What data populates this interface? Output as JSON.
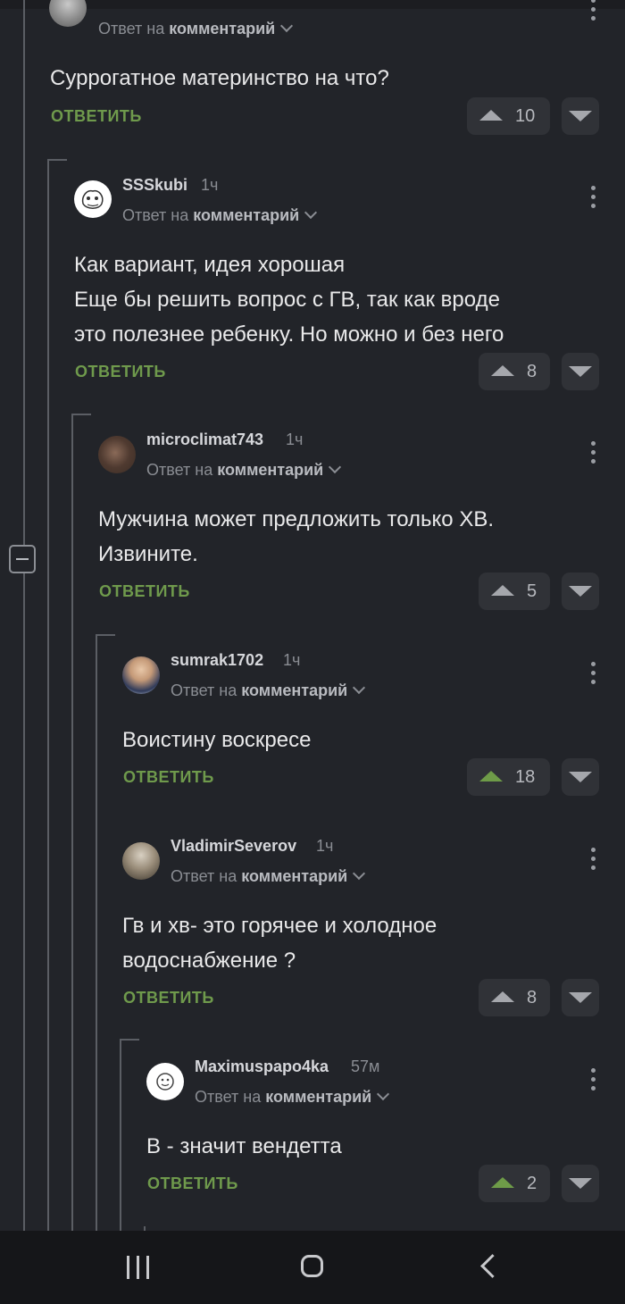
{
  "common": {
    "reply_to_prefix": "Ответ на",
    "reply_to_target": "комментарий",
    "reply_button": "ОТВЕТИТЬ"
  },
  "comments": [
    {
      "username": "",
      "time": "",
      "text_lines": [
        "Суррогатное материнство на что?"
      ],
      "rating": "10",
      "upvoted": false
    },
    {
      "username": "SSSkubi",
      "time": "1ч",
      "text_lines": [
        "Как вариант, идея хорошая",
        "Еще бы решить вопрос с ГВ, так как вроде",
        "это полезнее ребенку. Но можно и без него"
      ],
      "rating": "8",
      "upvoted": false
    },
    {
      "username": "microclimat743",
      "time": "1ч",
      "text_lines": [
        "Мужчина может предложить только ХВ.",
        "Извините."
      ],
      "rating": "5",
      "upvoted": false
    },
    {
      "username": "sumrak1702",
      "time": "1ч",
      "text_lines": [
        "Воистину воскресе"
      ],
      "rating": "18",
      "upvoted": true
    },
    {
      "username": "VladimirSeverov",
      "time": "1ч",
      "text_lines": [
        "Гв и хв- это горячее и холодное",
        "водоснабжение ?"
      ],
      "rating": "8",
      "upvoted": false
    },
    {
      "username": "Maximuspapo4ka",
      "time": "57м",
      "text_lines": [
        "В - значит вендетта"
      ],
      "rating": "2",
      "upvoted": true
    }
  ],
  "icons": {
    "collapse": "minus-square-icon",
    "more": "kebab-menu-icon",
    "upvote": "triangle-up-icon",
    "downvote": "triangle-down-icon",
    "chevron": "chevron-down-icon"
  },
  "colors": {
    "background": "#222429",
    "reply_green": "#6f9a4c",
    "upvoted_green": "#6e9b48",
    "button_bg": "#303237"
  }
}
